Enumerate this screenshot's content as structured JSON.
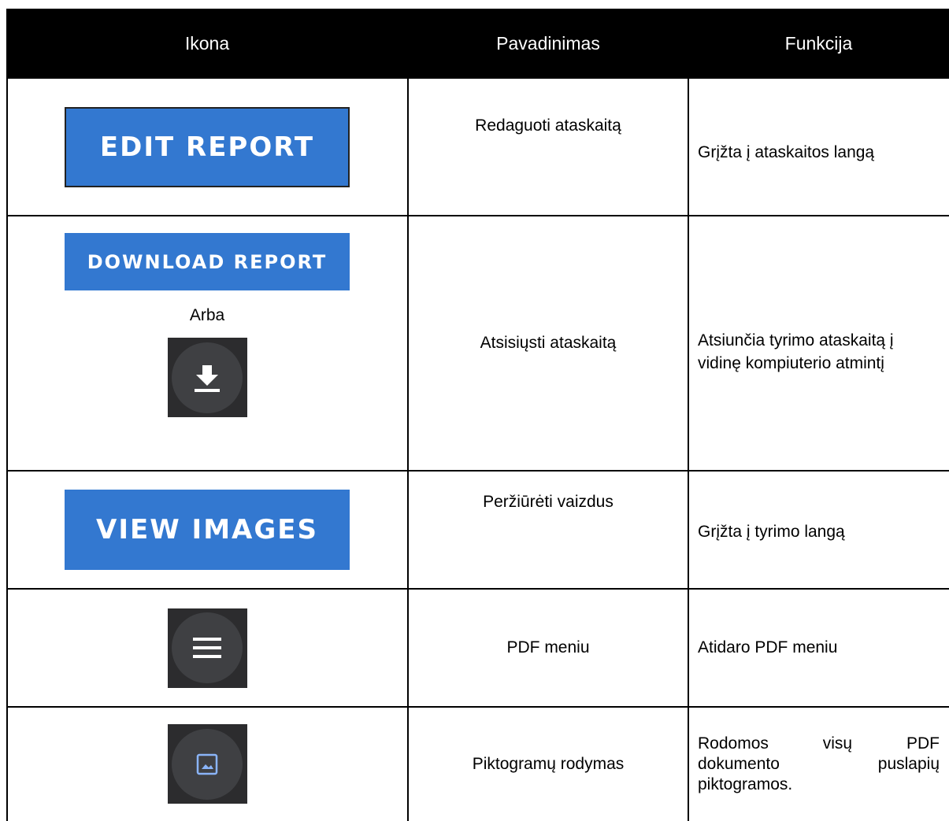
{
  "headers": [
    "Ikona",
    "Pavadinimas",
    "Funkcija"
  ],
  "rows": [
    {
      "icon_label": "EDIT REPORT",
      "name": "Redaguoti ataskaitą",
      "function": "Grįžta į ataskaitos langą"
    },
    {
      "icon_label": "DOWNLOAD REPORT",
      "icon_separator": "Arba",
      "icon_alt": "download-icon",
      "name": "Atsisiųsti ataskaitą",
      "function": "Atsiunčia tyrimo ataskaitą į vidinę kompiuterio atmintį"
    },
    {
      "icon_label": "VIEW IMAGES",
      "name": "Peržiūrėti vaizdus",
      "function": "Grįžta į tyrimo langą"
    },
    {
      "icon": "hamburger-menu-icon",
      "name": "PDF meniu",
      "function": "Atidaro PDF meniu"
    },
    {
      "icon": "image-thumbnail-icon",
      "name": "Piktogramų rodymas",
      "function_lines": [
        "Rodomos visų PDF",
        "dokumento puslapių",
        "piktogramos."
      ]
    }
  ],
  "colors": {
    "header_bg": "#000000",
    "button_blue": "#3378d0",
    "icon_dark": "#2c2c2e",
    "icon_circle": "#3f4043",
    "thumbnail_accent": "#8ab4f8"
  }
}
